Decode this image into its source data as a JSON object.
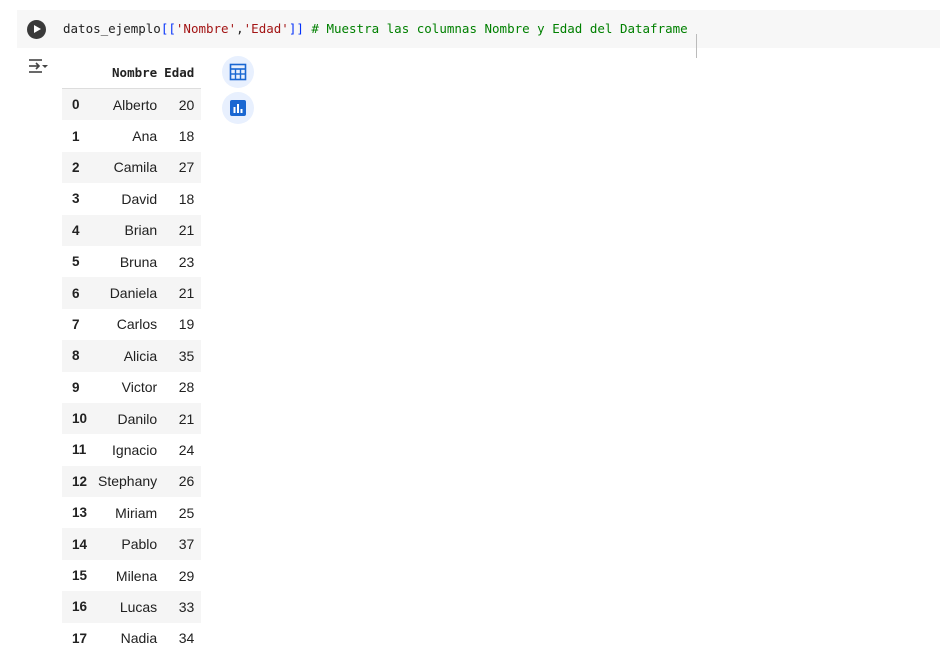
{
  "cell": {
    "code_parts": {
      "var": "datos_ejemplo",
      "open": "[[",
      "str1": "'Nombre'",
      "comma": ",",
      "str2": "'Edad'",
      "close": "]]",
      "comment": " # Muestra las columnas Nombre y Edad del Dataframe"
    },
    "run_icon": "play-circle-icon"
  },
  "output": {
    "toggle_icon": "output-options-icon",
    "table": {
      "columns": [
        "Nombre",
        "Edad"
      ],
      "rows": [
        {
          "index": "0",
          "Nombre": "Alberto",
          "Edad": "20"
        },
        {
          "index": "1",
          "Nombre": "Ana",
          "Edad": "18"
        },
        {
          "index": "2",
          "Nombre": "Camila",
          "Edad": "27"
        },
        {
          "index": "3",
          "Nombre": "David",
          "Edad": "18"
        },
        {
          "index": "4",
          "Nombre": "Brian",
          "Edad": "21"
        },
        {
          "index": "5",
          "Nombre": "Bruna",
          "Edad": "23"
        },
        {
          "index": "6",
          "Nombre": "Daniela",
          "Edad": "21"
        },
        {
          "index": "7",
          "Nombre": "Carlos",
          "Edad": "19"
        },
        {
          "index": "8",
          "Nombre": "Alicia",
          "Edad": "35"
        },
        {
          "index": "9",
          "Nombre": "Victor",
          "Edad": "28"
        },
        {
          "index": "10",
          "Nombre": "Danilo",
          "Edad": "21"
        },
        {
          "index": "11",
          "Nombre": "Ignacio",
          "Edad": "24"
        },
        {
          "index": "12",
          "Nombre": "Stephany",
          "Edad": "26"
        },
        {
          "index": "13",
          "Nombre": "Miriam",
          "Edad": "25"
        },
        {
          "index": "14",
          "Nombre": "Pablo",
          "Edad": "37"
        },
        {
          "index": "15",
          "Nombre": "Milena",
          "Edad": "29"
        },
        {
          "index": "16",
          "Nombre": "Lucas",
          "Edad": "33"
        },
        {
          "index": "17",
          "Nombre": "Nadia",
          "Edad": "34"
        }
      ]
    },
    "side_buttons": [
      {
        "icon": "interactive-table-icon"
      },
      {
        "icon": "suggest-charts-icon"
      }
    ]
  },
  "colors": {
    "string": "#a31515",
    "bracket": "#0431fa",
    "comment": "#008000",
    "accent": "#1967d2",
    "button_bg": "#e8f0fe"
  }
}
